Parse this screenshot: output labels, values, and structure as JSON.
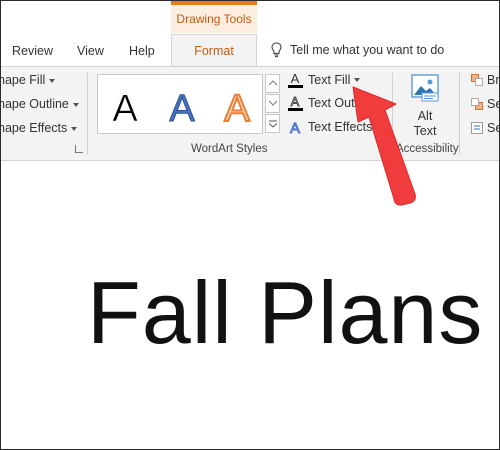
{
  "contextual_tab": {
    "header": "Drawing Tools",
    "accent": "#e97d14"
  },
  "tabs": [
    {
      "label": "Review"
    },
    {
      "label": "View"
    },
    {
      "label": "Help"
    }
  ],
  "active_tab": {
    "label": "Format"
  },
  "tell_me": {
    "text": "Tell me what you want to do",
    "icon": "lightbulb-icon"
  },
  "ribbon": {
    "shape_styles": {
      "items": [
        {
          "label": "hape Fill"
        },
        {
          "label": "hape Outline"
        },
        {
          "label": "hape Effects"
        }
      ]
    },
    "wordart_styles": {
      "group_label": "WordArt Styles",
      "samples": [
        {
          "letter": "A",
          "style": "black-fill",
          "color": "#000000"
        },
        {
          "letter": "A",
          "style": "blue-fill",
          "color": "#4472c4"
        },
        {
          "letter": "A",
          "style": "orange-outline",
          "color": "#ed7d31"
        }
      ],
      "commands": [
        {
          "label": "Text Fill",
          "icon": "text-fill-icon",
          "swatch": "#000000"
        },
        {
          "label": "Text Outline",
          "icon": "text-outline-icon",
          "swatch": "#000000"
        },
        {
          "label": "Text Effects",
          "icon": "text-effects-icon"
        }
      ]
    },
    "accessibility": {
      "group_label": "Accessibility",
      "alt_text_line1": "Alt",
      "alt_text_line2": "Text"
    },
    "arrange": {
      "items": [
        {
          "label": "Br"
        },
        {
          "label": "Se"
        },
        {
          "label": "Se"
        }
      ]
    }
  },
  "document": {
    "text": "Fall Plans"
  },
  "annotation": {
    "color": "#f03c3c"
  }
}
